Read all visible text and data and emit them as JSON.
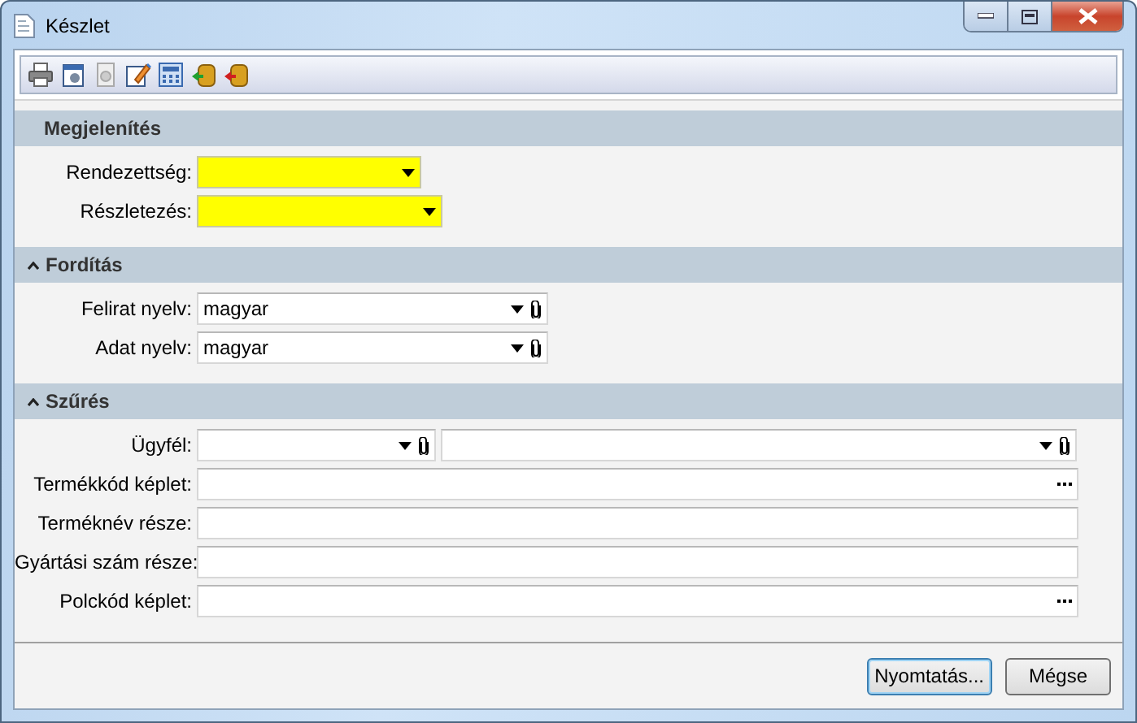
{
  "window": {
    "title": "Készlet"
  },
  "sections": [
    {
      "title": "Megjelenítés",
      "collapsible": false,
      "rows": [
        {
          "label": "Rendezettség:",
          "fields": [
            {
              "kind": "combo",
              "required": true
            }
          ]
        },
        {
          "label": "Részletezés:",
          "fields": [
            {
              "kind": "combo",
              "required": true
            }
          ]
        }
      ]
    },
    {
      "title": "Fordítás",
      "collapsible": true,
      "rows": [
        {
          "label": "Felirat nyelv:",
          "fields": [
            {
              "kind": "lookup",
              "required": false,
              "value": "magyar"
            }
          ]
        },
        {
          "label": "Adat nyelv:",
          "fields": [
            {
              "kind": "lookup",
              "required": false,
              "value": "magyar"
            }
          ]
        }
      ]
    },
    {
      "title": "Szűrés",
      "collapsible": true,
      "rows": [
        {
          "label": "Ügyfél:",
          "fields": [
            {
              "kind": "lookup",
              "required": false
            },
            {
              "kind": "lookup",
              "required": false
            }
          ]
        },
        {
          "label": "Termékkód képlet:",
          "fields": [
            {
              "kind": "browse",
              "required": false
            }
          ]
        },
        {
          "label": "Terméknév része:",
          "fields": [
            {
              "kind": "text",
              "required": false
            }
          ]
        },
        {
          "label": "Gyártási szám része:",
          "fields": [
            {
              "kind": "text",
              "required": false
            }
          ]
        },
        {
          "label": "Polckód képlet:",
          "fields": [
            {
              "kind": "browse",
              "required": false
            }
          ]
        }
      ]
    }
  ],
  "buttons": [
    {
      "label": "Nyomtatás...",
      "default": true
    },
    {
      "label": "Mégse",
      "default": false
    }
  ]
}
